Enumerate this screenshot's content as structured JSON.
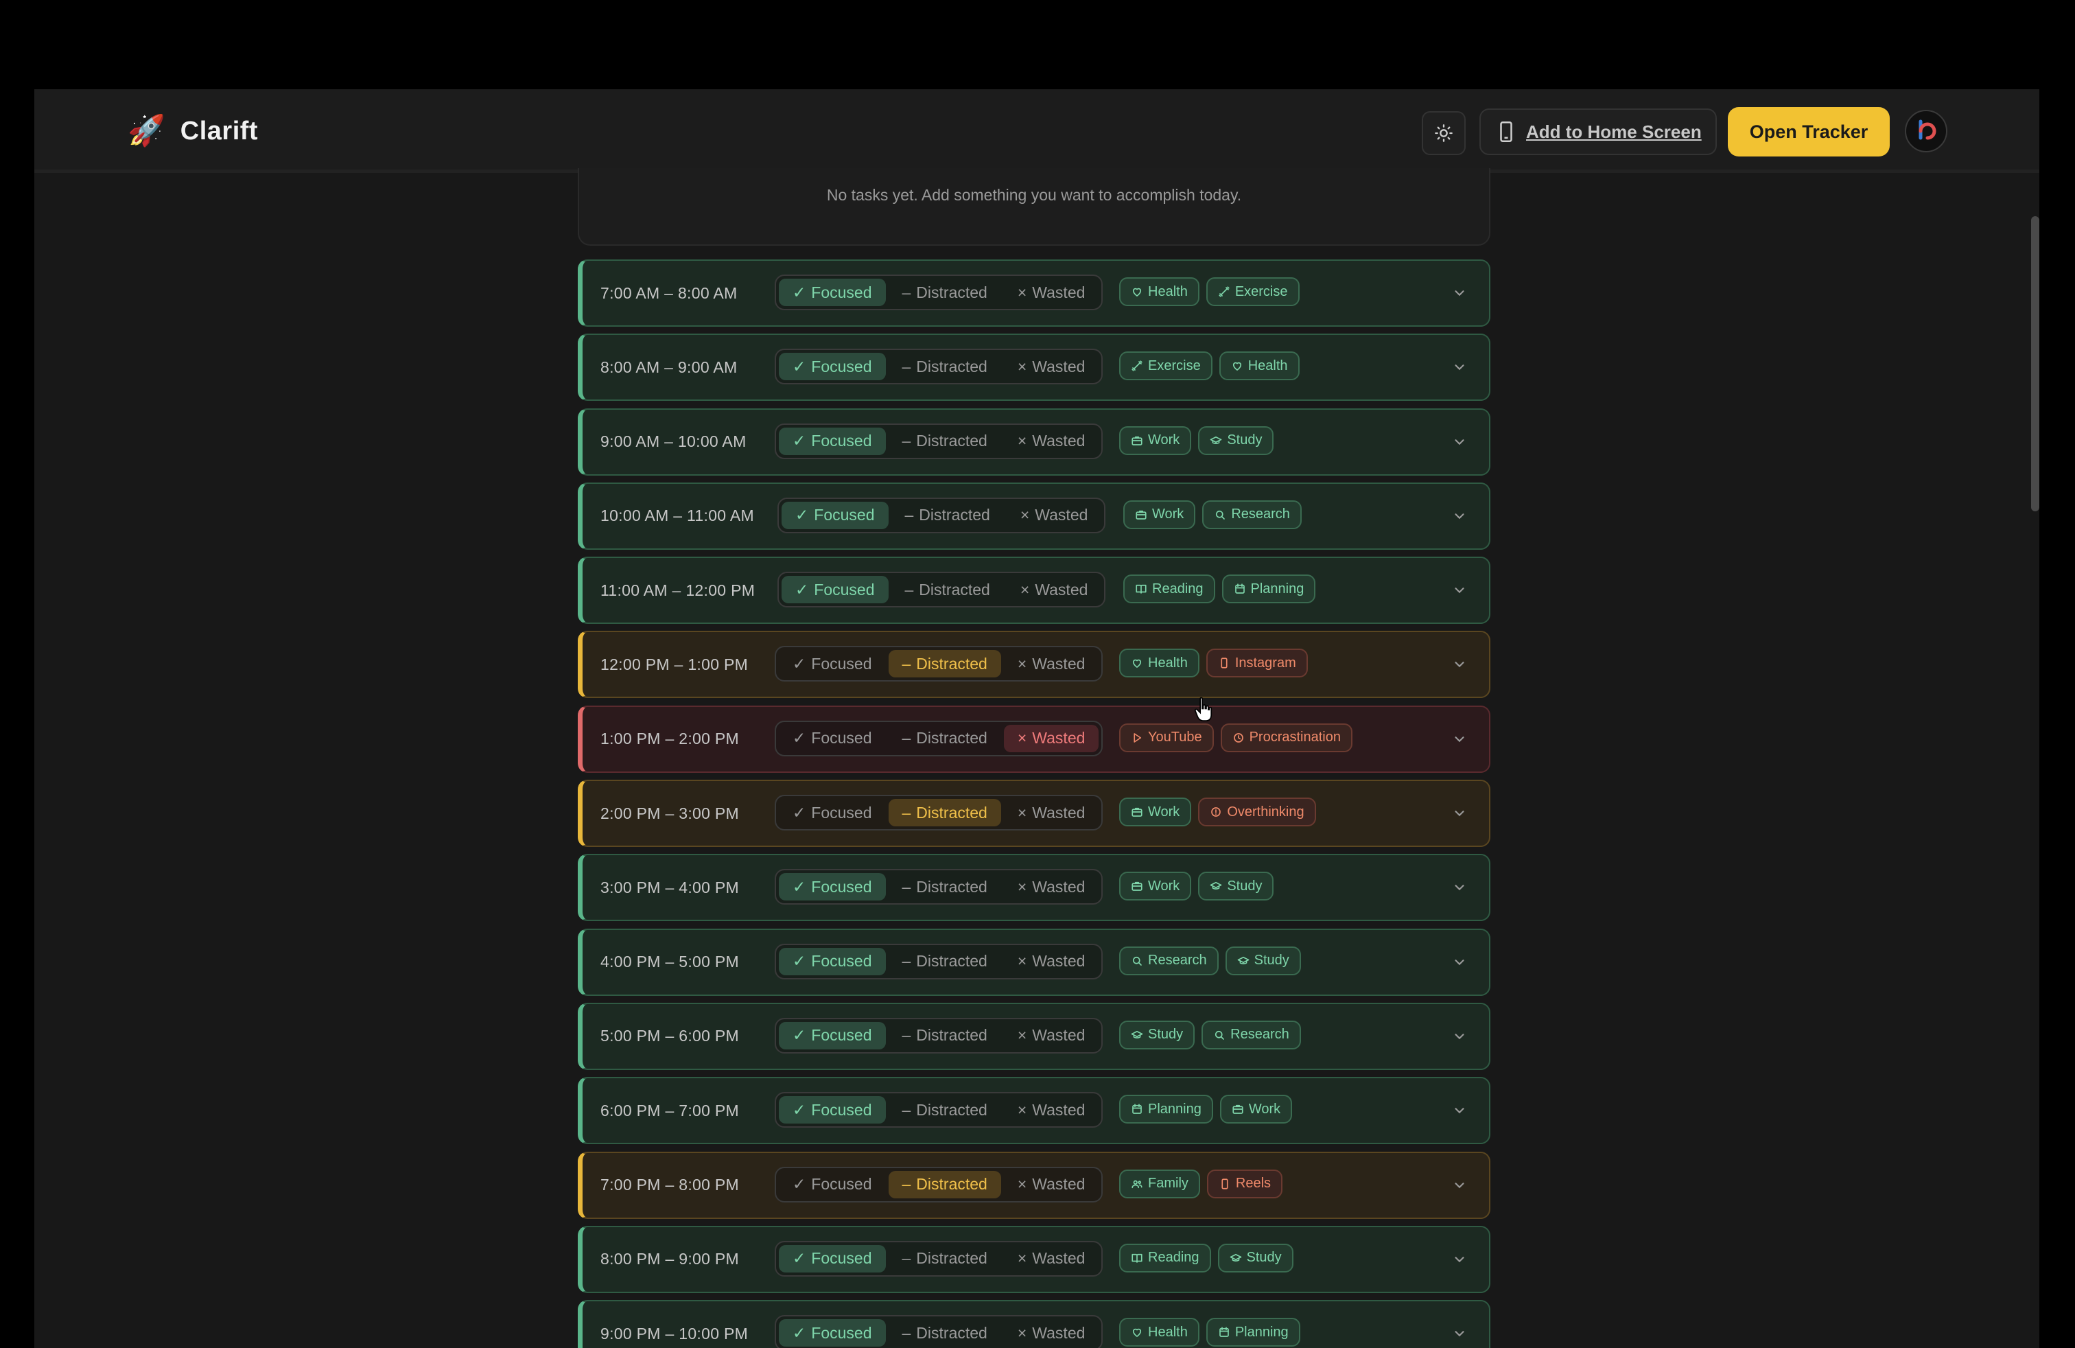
{
  "header": {
    "brand": "Clarift",
    "rocket_glyph": "🚀",
    "add_home_label": "Add to Home Screen",
    "open_tracker_label": "Open Tracker",
    "colors": {
      "accent": "#f2c232",
      "focused": "#5ab58a",
      "distracted": "#e8b73b",
      "wasted": "#e06a6a"
    }
  },
  "tasks": {
    "empty_text": "No tasks yet. Add something you want to accomplish today."
  },
  "options": {
    "focused": "Focused",
    "distracted": "Distracted",
    "wasted": "Wasted"
  },
  "hours": [
    {
      "time": "7:00 AM – 8:00 AM",
      "status": "focused",
      "tags": [
        {
          "label": "Health",
          "icon": "heart",
          "kind": "good"
        },
        {
          "label": "Exercise",
          "icon": "dumbbell",
          "kind": "good"
        }
      ]
    },
    {
      "time": "8:00 AM – 9:00 AM",
      "status": "focused",
      "tags": [
        {
          "label": "Exercise",
          "icon": "dumbbell",
          "kind": "good"
        },
        {
          "label": "Health",
          "icon": "heart",
          "kind": "good"
        }
      ]
    },
    {
      "time": "9:00 AM – 10:00 AM",
      "status": "focused",
      "tags": [
        {
          "label": "Work",
          "icon": "briefcase",
          "kind": "good"
        },
        {
          "label": "Study",
          "icon": "graduation-cap",
          "kind": "good"
        }
      ]
    },
    {
      "time": "10:00 AM – 11:00 AM",
      "status": "focused",
      "tags": [
        {
          "label": "Work",
          "icon": "briefcase",
          "kind": "good"
        },
        {
          "label": "Research",
          "icon": "search",
          "kind": "good"
        }
      ]
    },
    {
      "time": "11:00 AM – 12:00 PM",
      "status": "focused",
      "tags": [
        {
          "label": "Reading",
          "icon": "book",
          "kind": "good"
        },
        {
          "label": "Planning",
          "icon": "calendar",
          "kind": "good"
        }
      ]
    },
    {
      "time": "12:00 PM – 1:00 PM",
      "status": "distracted",
      "tags": [
        {
          "label": "Health",
          "icon": "heart",
          "kind": "good"
        },
        {
          "label": "Instagram",
          "icon": "phone",
          "kind": "bad"
        }
      ]
    },
    {
      "time": "1:00 PM – 2:00 PM",
      "status": "wasted",
      "tags": [
        {
          "label": "YouTube",
          "icon": "play",
          "kind": "bad"
        },
        {
          "label": "Procrastination",
          "icon": "clock",
          "kind": "bad"
        }
      ]
    },
    {
      "time": "2:00 PM – 3:00 PM",
      "status": "distracted",
      "tags": [
        {
          "label": "Work",
          "icon": "briefcase",
          "kind": "good"
        },
        {
          "label": "Overthinking",
          "icon": "alert",
          "kind": "bad"
        }
      ]
    },
    {
      "time": "3:00 PM – 4:00 PM",
      "status": "focused",
      "tags": [
        {
          "label": "Work",
          "icon": "briefcase",
          "kind": "good"
        },
        {
          "label": "Study",
          "icon": "graduation-cap",
          "kind": "good"
        }
      ]
    },
    {
      "time": "4:00 PM – 5:00 PM",
      "status": "focused",
      "tags": [
        {
          "label": "Research",
          "icon": "search",
          "kind": "good"
        },
        {
          "label": "Study",
          "icon": "graduation-cap",
          "kind": "good"
        }
      ]
    },
    {
      "time": "5:00 PM – 6:00 PM",
      "status": "focused",
      "tags": [
        {
          "label": "Study",
          "icon": "graduation-cap",
          "kind": "good"
        },
        {
          "label": "Research",
          "icon": "search",
          "kind": "good"
        }
      ]
    },
    {
      "time": "6:00 PM – 7:00 PM",
      "status": "focused",
      "tags": [
        {
          "label": "Planning",
          "icon": "calendar",
          "kind": "good"
        },
        {
          "label": "Work",
          "icon": "briefcase",
          "kind": "good"
        }
      ]
    },
    {
      "time": "7:00 PM – 8:00 PM",
      "status": "distracted",
      "tags": [
        {
          "label": "Family",
          "icon": "users",
          "kind": "good"
        },
        {
          "label": "Reels",
          "icon": "phone",
          "kind": "bad"
        }
      ]
    },
    {
      "time": "8:00 PM – 9:00 PM",
      "status": "focused",
      "tags": [
        {
          "label": "Reading",
          "icon": "book",
          "kind": "good"
        },
        {
          "label": "Study",
          "icon": "graduation-cap",
          "kind": "good"
        }
      ]
    },
    {
      "time": "9:00 PM – 10:00 PM",
      "status": "focused",
      "tags": [
        {
          "label": "Health",
          "icon": "heart",
          "kind": "good"
        },
        {
          "label": "Planning",
          "icon": "calendar",
          "kind": "good"
        }
      ]
    }
  ]
}
